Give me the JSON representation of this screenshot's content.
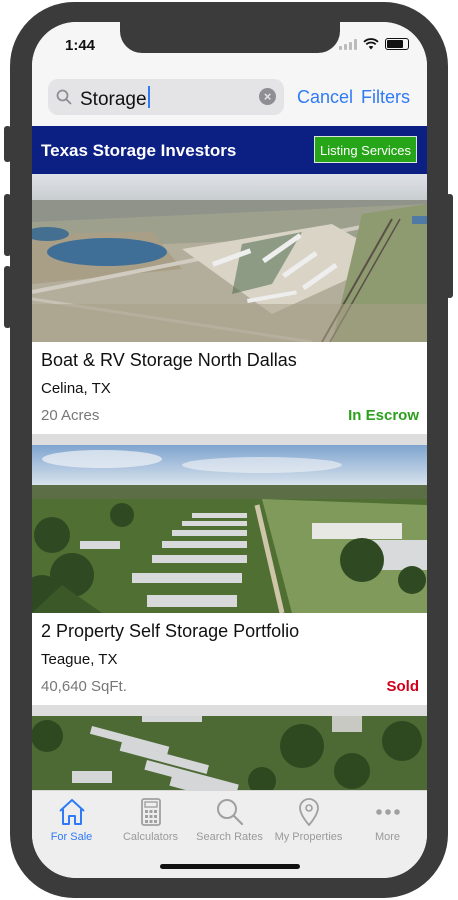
{
  "status_bar": {
    "time": "1:44"
  },
  "search": {
    "query": "Storage",
    "cancel_label": "Cancel",
    "filters_label": "Filters"
  },
  "banner": {
    "title": "Texas Storage Investors",
    "button_label": "Listing Services"
  },
  "listings": [
    {
      "title": "Boat & RV Storage North Dallas",
      "location": "Celina, TX",
      "size": "20 Acres",
      "status": "In Escrow",
      "status_color": "#2ca01c"
    },
    {
      "title": "2 Property Self Storage Portfolio",
      "location": "Teague, TX",
      "size": "40,640 SqFt.",
      "status": "Sold",
      "status_color": "#d0021b"
    }
  ],
  "tabbar": {
    "tabs": [
      {
        "label": "For Sale",
        "icon": "house-icon",
        "active": true
      },
      {
        "label": "Calculators",
        "icon": "calculator-icon"
      },
      {
        "label": "Search Rates",
        "icon": "magnifier-icon"
      },
      {
        "label": "My Properties",
        "icon": "location-pin-icon"
      },
      {
        "label": "More",
        "icon": "more-dots-icon"
      }
    ]
  },
  "colors": {
    "accent": "#2f7bf6",
    "banner": "#0c1f83",
    "listing_button": "#27a519"
  }
}
